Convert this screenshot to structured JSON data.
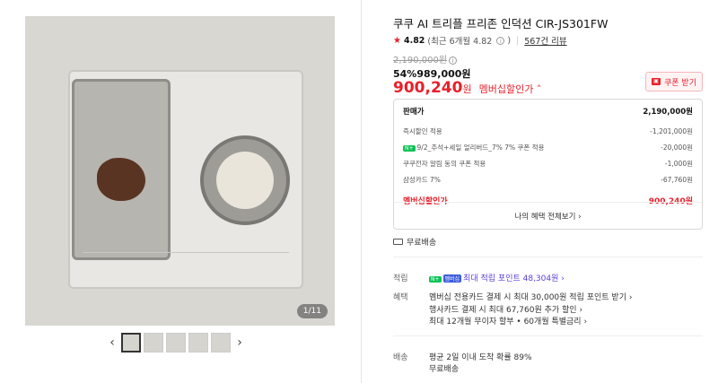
{
  "gallery": {
    "counter": "1/11",
    "prev_arrow": "‹",
    "next_arrow": "›",
    "thumbnail_count": 5
  },
  "product": {
    "title": "쿠쿠 AI 트리플 프리존 인덕션 CIR-JS301FW",
    "rating_value": "4.82",
    "rating_detail": "(최근 6개월 4.82",
    "rating_detail_close": ")",
    "review_count": "567건 리뷰",
    "original_price": "2,190,000원",
    "discount": "54%989,000원",
    "member_price_num": "900,240",
    "member_price_unit": "원",
    "member_price_label": "멤버십할인가 ˄",
    "coupon_label": "쿠폰 받기"
  },
  "breakdown": {
    "head_label": "판매가",
    "head_value": "2,190,000원",
    "rows": [
      {
        "label": "즉시할인 적용",
        "value": "-1,201,000원"
      },
      {
        "label": "9/2_추석+세일 얼리버드_7% 7% 쿠폰 적용",
        "value": "-20,000원"
      },
      {
        "label": "쿠쿠전자 알림 동의 쿠폰 적용",
        "value": "-1,000원"
      },
      {
        "label": "삼성카드 7%",
        "value": "-67,760원"
      }
    ],
    "member_label": "멤버십할인가",
    "member_value": "900,240원",
    "footer": "나의 혜택 전체보기 ›"
  },
  "shipping_short": "무료배송",
  "points": {
    "label": "적립",
    "value": "최대 적립 포인트 48,304원 ›"
  },
  "benefits": {
    "label": "혜택",
    "lines": [
      "멤버십 전용카드 결제 시 최대 30,000원 적립 포인트 받기 ›",
      "행사카드 결제 시 최대 67,760원 추가 할인 ›",
      "최대 12개월 무이자 할부 • 60개월 특별금리 ›"
    ]
  },
  "delivery": {
    "label": "배송",
    "lines": [
      "평균 2일 이내 도착 확률 89%",
      "무료배송"
    ]
  },
  "colors": {
    "accent": "#e8202a",
    "naver_green": "#0dc356",
    "points_purple": "#5a3fd6"
  }
}
